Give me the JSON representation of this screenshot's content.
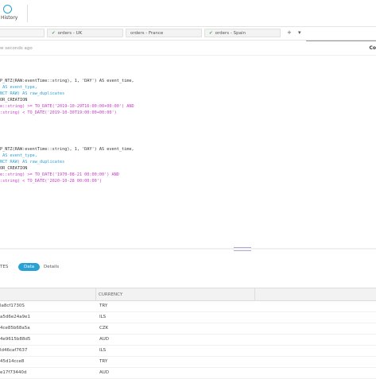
{
  "toolbar": {
    "history_label": "History"
  },
  "tabs": [
    {
      "label": ""
    },
    {
      "label": "orders - UK"
    },
    {
      "label": "orders - France"
    },
    {
      "label": "orders - Spain"
    }
  ],
  "tab_buttons": {
    "add": "+",
    "menu": "▾"
  },
  "status": {
    "ago": "w seconds ago",
    "right": "Co"
  },
  "code_block_1": [
    "P_NTZ(RAW:eventTime::string), 1, 'DAY') AS event_time,",
    " AS event_type,",
    "NCT RAW) AS raw_duplicates",
    "OR_CREATION",
    "e::string) >= TO_DATE('2019-10-29T16:00:00+00:00') AND",
    ":string) < TO_DATE('2019-10-30T19:00:00+00:00')"
  ],
  "code_block_2": [
    "P_NTZ(RAW:eventTime::string), 1, 'DAY') AS event_time,",
    " AS event_type,",
    "NCT RAW) AS raw_duplicates",
    "OR_CREATION",
    "e::string) >= TO_DATE('1970-08-21 00:00:00') AND",
    ":string) < TO_DATE('2020-10-28 00:00:00')"
  ],
  "result_tabs": {
    "tes": "TES",
    "data": "Data",
    "details": "Details"
  },
  "table": {
    "currency_header": "CURRENCY",
    "rows": [
      {
        "id": "la8cf1730S",
        "currency": "TRY"
      },
      {
        "id": "a5d6e24a9e1",
        "currency": "ILS"
      },
      {
        "id": "4ce85b68a5a",
        "currency": "CZK"
      },
      {
        "id": "4e9615b88d5",
        "currency": "AUD"
      },
      {
        "id": "ld46caf7637",
        "currency": "ILS"
      },
      {
        "id": "45d14cce8",
        "currency": "TRY"
      },
      {
        "id": "e17f73440d",
        "currency": "AUD"
      }
    ]
  }
}
